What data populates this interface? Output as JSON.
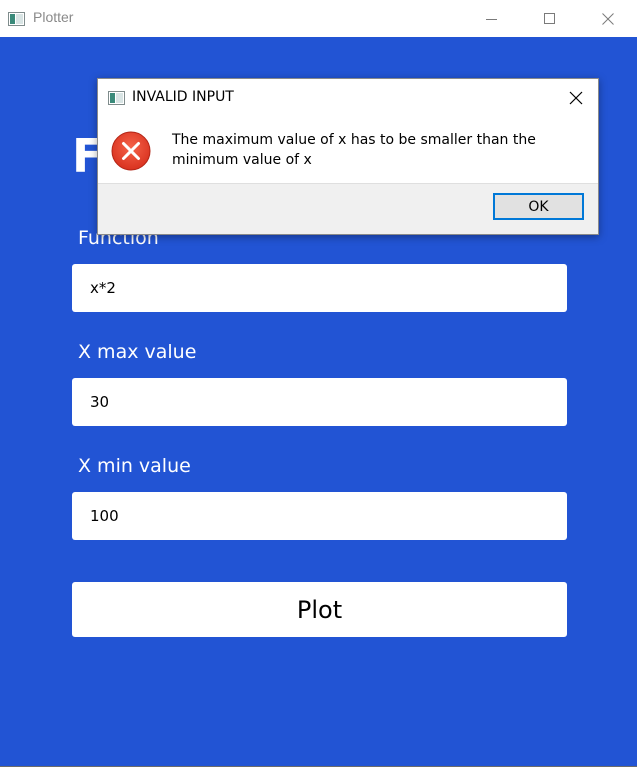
{
  "window": {
    "title": "Plotter",
    "icon": "app-window-icon"
  },
  "main": {
    "heading_partial": "F",
    "background": "#2254d4",
    "fields": [
      {
        "label": "Function",
        "value": "x*2"
      },
      {
        "label": "X max value",
        "value": "30"
      },
      {
        "label": "X min value",
        "value": "100"
      }
    ],
    "plot_label": "Plot"
  },
  "dialog": {
    "title": "INVALID INPUT",
    "icon": "error-icon",
    "message": "The maximum value of x has to be smaller than the minimum value of x",
    "ok_label": "OK",
    "accent": "#0078d7",
    "error_color": "#e81123"
  }
}
